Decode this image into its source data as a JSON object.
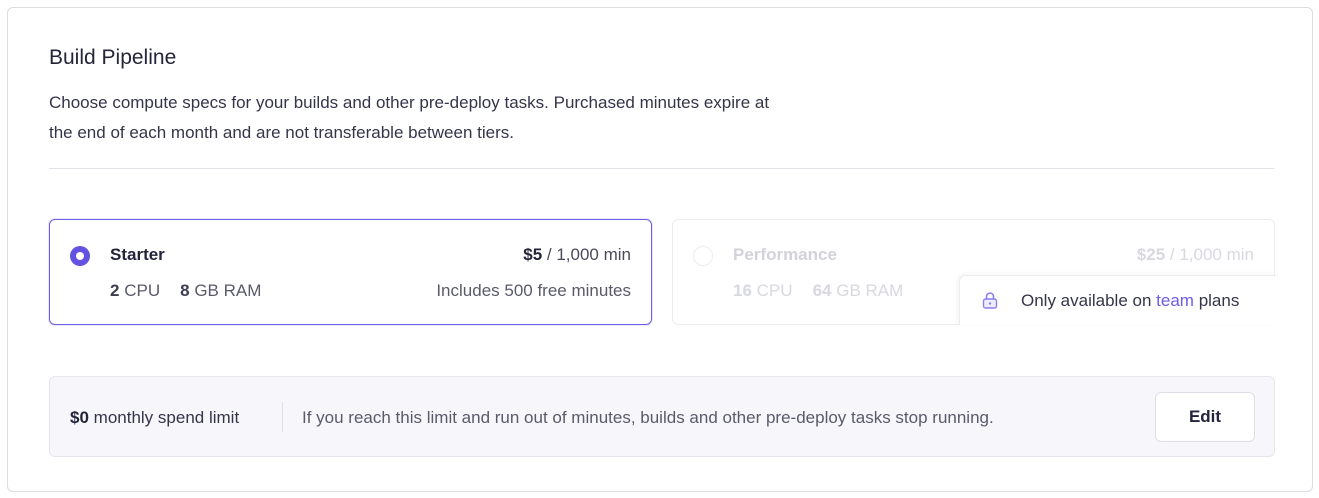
{
  "section": {
    "title": "Build Pipeline",
    "description": "Choose compute specs for your builds and other pre-deploy tasks. Purchased minutes expire at the end of each month and are not transferable between tiers."
  },
  "tiers": [
    {
      "name": "Starter",
      "selected": true,
      "price_amount": "$5",
      "price_unit": "/ 1,000 min",
      "cpu_value": "2",
      "cpu_label": "CPU",
      "ram_value": "8",
      "ram_label": "GB RAM",
      "note": "Includes 500 free minutes"
    },
    {
      "name": "Performance",
      "selected": false,
      "disabled": true,
      "price_amount": "$25",
      "price_unit": "/ 1,000 min",
      "cpu_value": "16",
      "cpu_label": "CPU",
      "ram_value": "64",
      "ram_label": "GB RAM",
      "tooltip": {
        "icon": "lock-icon",
        "prefix": "Only available on",
        "link": "team",
        "suffix": "plans"
      }
    }
  ],
  "spend_limit": {
    "amount": "$0",
    "label": "monthly spend limit",
    "description": "If you reach this limit and run out of minutes, builds and other pre-deploy tasks stop running.",
    "edit_label": "Edit"
  },
  "colors": {
    "accent": "#6c5ce7",
    "radio_selected": "#6253e1",
    "lock_icon": "#8a7ff0"
  }
}
